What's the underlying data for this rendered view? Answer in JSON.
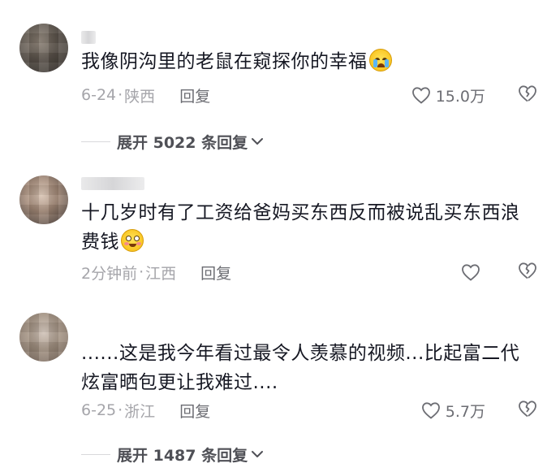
{
  "comments": [
    {
      "text": "我像阴沟里的老鼠在窥探你的幸福",
      "emoji": "loudly-crying-emoji",
      "time": "6-24",
      "dot": "·",
      "location": "陕西",
      "reply_label": "回复",
      "likes": "15.0万",
      "expand_label": "展开 5022 条回复"
    },
    {
      "text_line1": "十几岁时有了工资给爸妈买东西反而被说乱买东西浪",
      "text_line2": "费钱",
      "emoji": "flushed-emoji",
      "time": "2分钟前",
      "dot": "·",
      "location": "江西",
      "reply_label": "回复",
      "likes": ""
    },
    {
      "text_line1": "......这是我今年看过最令人羡慕的视频...比起富二代",
      "text_line2": "炫富晒包更让我难过....",
      "time": "6-25",
      "dot": "·",
      "location": "浙江",
      "reply_label": "回复",
      "likes": "5.7万",
      "expand_label": "展开 1487 条回复"
    }
  ],
  "icons": {
    "like": "heart-outline-icon",
    "dislike": "broken-heart-icon",
    "expand": "chevron-down-icon"
  }
}
